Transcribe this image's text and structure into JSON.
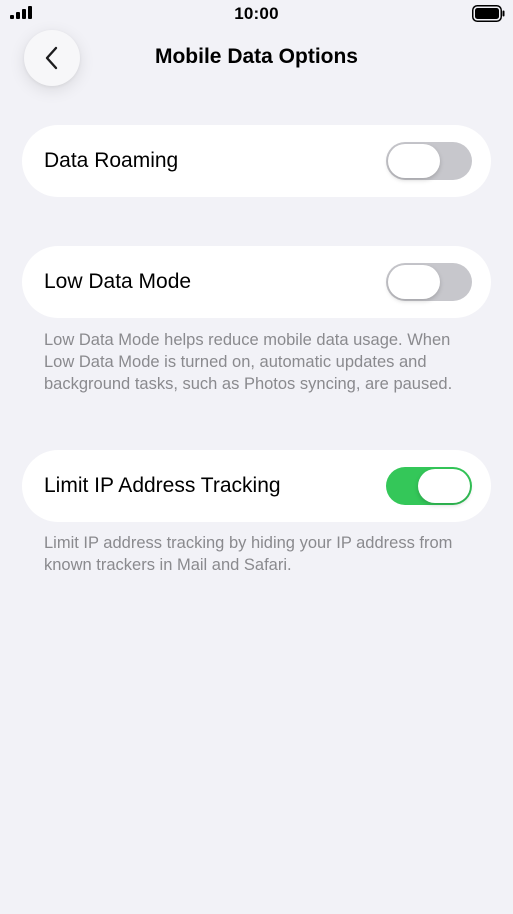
{
  "status_bar": {
    "time": "10:00"
  },
  "nav": {
    "title": "Mobile Data Options",
    "back_icon": "chevron-left-icon"
  },
  "settings": {
    "data_roaming": {
      "label": "Data Roaming",
      "enabled": false
    },
    "low_data_mode": {
      "label": "Low Data Mode",
      "enabled": false,
      "footnote": "Low Data Mode helps reduce mobile data usage. When Low Data Mode is turned on, automatic updates and background tasks, such as Photos syncing, are paused."
    },
    "limit_ip_tracking": {
      "label": "Limit IP Address Tracking",
      "enabled": true,
      "footnote": "Limit IP address tracking by hiding your IP address from known trackers in Mail and Safari."
    }
  },
  "colors": {
    "background": "#f2f2f7",
    "toggle_on": "#34c759",
    "toggle_off": "#c7c7cc",
    "footnote_text": "#8a8a8e"
  }
}
